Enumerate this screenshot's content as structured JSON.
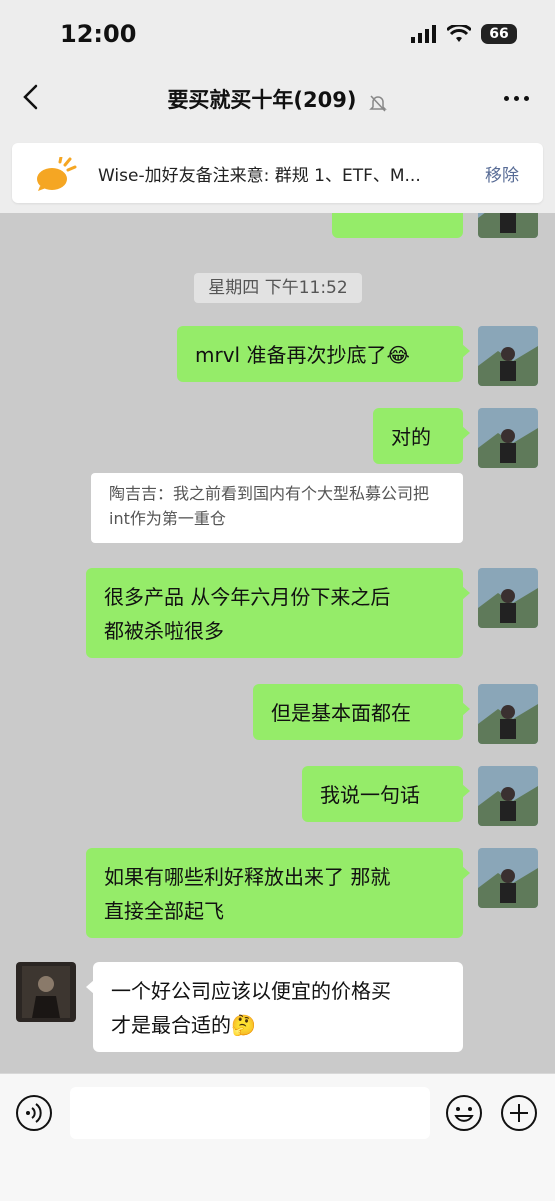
{
  "status": {
    "time": "12:00",
    "battery": "66"
  },
  "header": {
    "title": "要买就买十年(209)"
  },
  "pinned": {
    "text": "Wise-加好友备注来意: 群规 1、ETF、M...",
    "action": "移除"
  },
  "chat": {
    "timestamp": "星期四 下午11:52",
    "messages": [
      {
        "text": "mrvl 准备再次抄底了😂"
      },
      {
        "text": "对的"
      },
      {
        "quote": "陶吉吉：我之前看到国内有个大型私募公司把int作为第一重仓"
      },
      {
        "text_lines": [
          "很多产品 从今年六月份下来之后",
          "都被杀啦很多"
        ]
      },
      {
        "text": "但是基本面都在"
      },
      {
        "text": "我说一句话"
      },
      {
        "text_lines": [
          "如果有哪些利好释放出来了 那就",
          "直接全部起飞"
        ]
      },
      {
        "text_lines": [
          "一个好公司应该以便宜的价格买",
          "才是最合适的🤔"
        ]
      }
    ]
  }
}
